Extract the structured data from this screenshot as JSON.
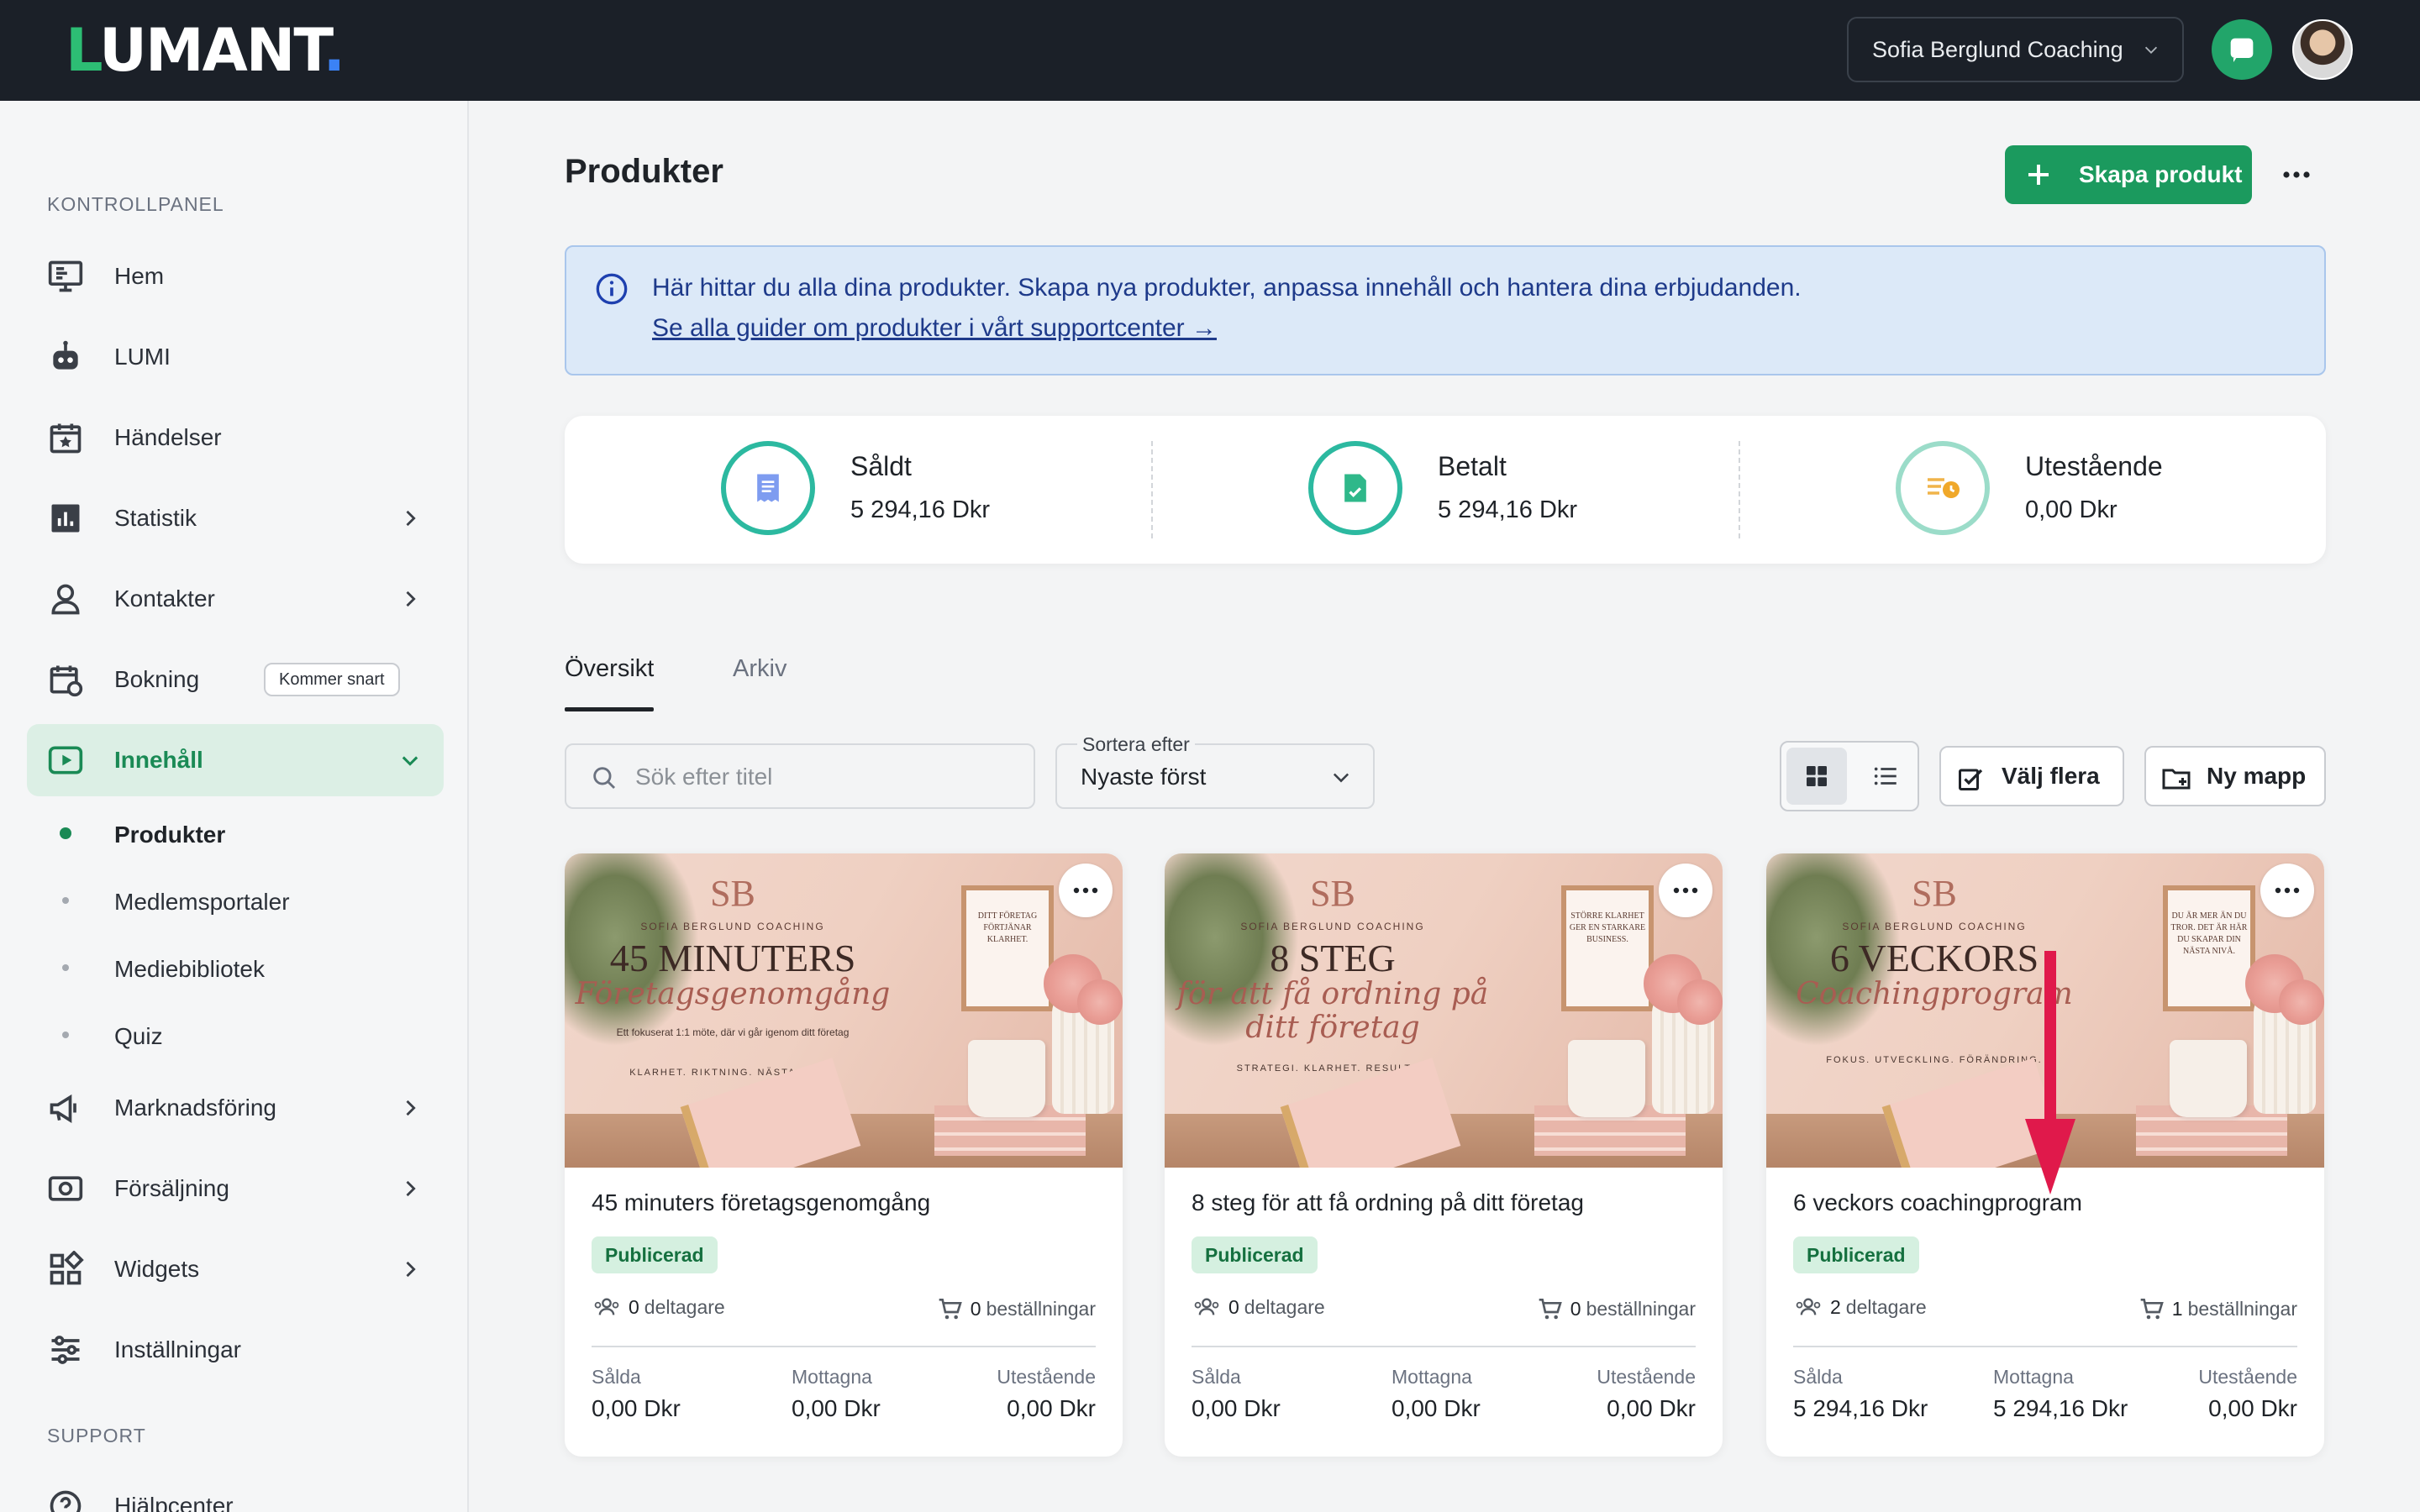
{
  "topbar": {
    "logo_l": "L",
    "logo_rest": "UMANT",
    "logo_dot": ".",
    "account_name": "Sofia Berglund Coaching"
  },
  "sidebar": {
    "section_dashboard": "KONTROLLPANEL",
    "section_support": "SUPPORT",
    "items": [
      {
        "label": "Hem",
        "icon": "monitor-icon"
      },
      {
        "label": "LUMI",
        "icon": "robot-icon"
      },
      {
        "label": "Händelser",
        "icon": "calendar-star-icon"
      },
      {
        "label": "Statistik",
        "icon": "chart-icon"
      },
      {
        "label": "Kontakter",
        "icon": "user-icon"
      },
      {
        "label": "Bokning",
        "icon": "calendar-refresh-icon",
        "badge": "Kommer snart"
      },
      {
        "label": "Innehåll",
        "icon": "play-icon"
      },
      {
        "label": "Marknadsföring",
        "icon": "megaphone-icon"
      },
      {
        "label": "Försäljning",
        "icon": "money-icon"
      },
      {
        "label": "Widgets",
        "icon": "widgets-icon"
      },
      {
        "label": "Inställningar",
        "icon": "sliders-icon"
      },
      {
        "label": "Hjälpcenter",
        "icon": "help-icon"
      }
    ],
    "sub_items": [
      "Produkter",
      "Medlemsportaler",
      "Mediebibliotek",
      "Quiz"
    ],
    "accent": "#1a8a55"
  },
  "main": {
    "title": "Produkter",
    "create_label": "Skapa produkt",
    "info_text": "Här hittar du alla dina produkter. Skapa nya produkter, anpassa innehåll och hantera dina erbjudanden.",
    "info_link": "Se alla guider om produkter i vårt supportcenter →",
    "stats": [
      {
        "label": "Såldt",
        "value": "5 294,16 Dkr"
      },
      {
        "label": "Betalt",
        "value": "5 294,16 Dkr"
      },
      {
        "label": "Utestående",
        "value": "0,00 Dkr"
      }
    ],
    "tabs": [
      "Översikt",
      "Arkiv"
    ],
    "search_placeholder": "Sök efter titel",
    "sort_label": "Sortera efter",
    "sort_value": "Nyaste först",
    "select_multiple": "Välj flera",
    "new_folder": "Ny mapp"
  },
  "products": [
    {
      "title": "45 minuters företagsgenomgång",
      "status": "Publicerad",
      "participants": "0",
      "participants_label": "deltagare",
      "orders": "0",
      "orders_label": "beställningar",
      "sold_label": "Sålda",
      "sold": "0,00 Dkr",
      "received_label": "Mottagna",
      "received": "0,00 Dkr",
      "outstanding_label": "Utestående",
      "outstanding": "0,00 Dkr",
      "thumb": {
        "monogram": "SB",
        "brand": "SOFIA BERGLUND COACHING",
        "headline": "45 MINUTERS",
        "script": "Företagsgenomgång",
        "small": "Ett fokuserat 1:1 möte, där vi går igenom ditt företag",
        "tagline": "KLARHET. RIKTNING. NÄSTA STEG.",
        "frame": "DITT FÖRETAG FÖRTJÄNAR KLARHET."
      }
    },
    {
      "title": "8 steg för att få ordning på ditt företag",
      "status": "Publicerad",
      "participants": "0",
      "participants_label": "deltagare",
      "orders": "0",
      "orders_label": "beställningar",
      "sold_label": "Sålda",
      "sold": "0,00 Dkr",
      "received_label": "Mottagna",
      "received": "0,00 Dkr",
      "outstanding_label": "Utestående",
      "outstanding": "0,00 Dkr",
      "thumb": {
        "monogram": "SB",
        "brand": "SOFIA BERGLUND COACHING",
        "headline": "8 STEG",
        "script": "för att få ordning på ditt företag",
        "small": "",
        "tagline": "STRATEGI. KLARHET. RESULTAT.",
        "frame": "STÖRRE KLARHET GER EN STARKARE BUSINESS."
      }
    },
    {
      "title": "6 veckors coachingprogram",
      "status": "Publicerad",
      "participants": "2",
      "participants_label": "deltagare",
      "orders": "1",
      "orders_label": "beställningar",
      "sold_label": "Sålda",
      "sold": "5 294,16 Dkr",
      "received_label": "Mottagna",
      "received": "5 294,16 Dkr",
      "outstanding_label": "Utestående",
      "outstanding": "0,00 Dkr",
      "thumb": {
        "monogram": "SB",
        "brand": "SOFIA BERGLUND COACHING",
        "headline": "6 VECKORS",
        "script": "Coachingprogram",
        "small": "",
        "tagline": "FOKUS. UTVECKLING. FÖRÄNDRING.",
        "frame": "DU ÄR MER ÄN DU TROR. DET ÄR HÄR DU SKAPAR DIN NÄSTA NIVÅ."
      }
    }
  ],
  "annotation": {
    "arrow_color": "#e0194b"
  }
}
